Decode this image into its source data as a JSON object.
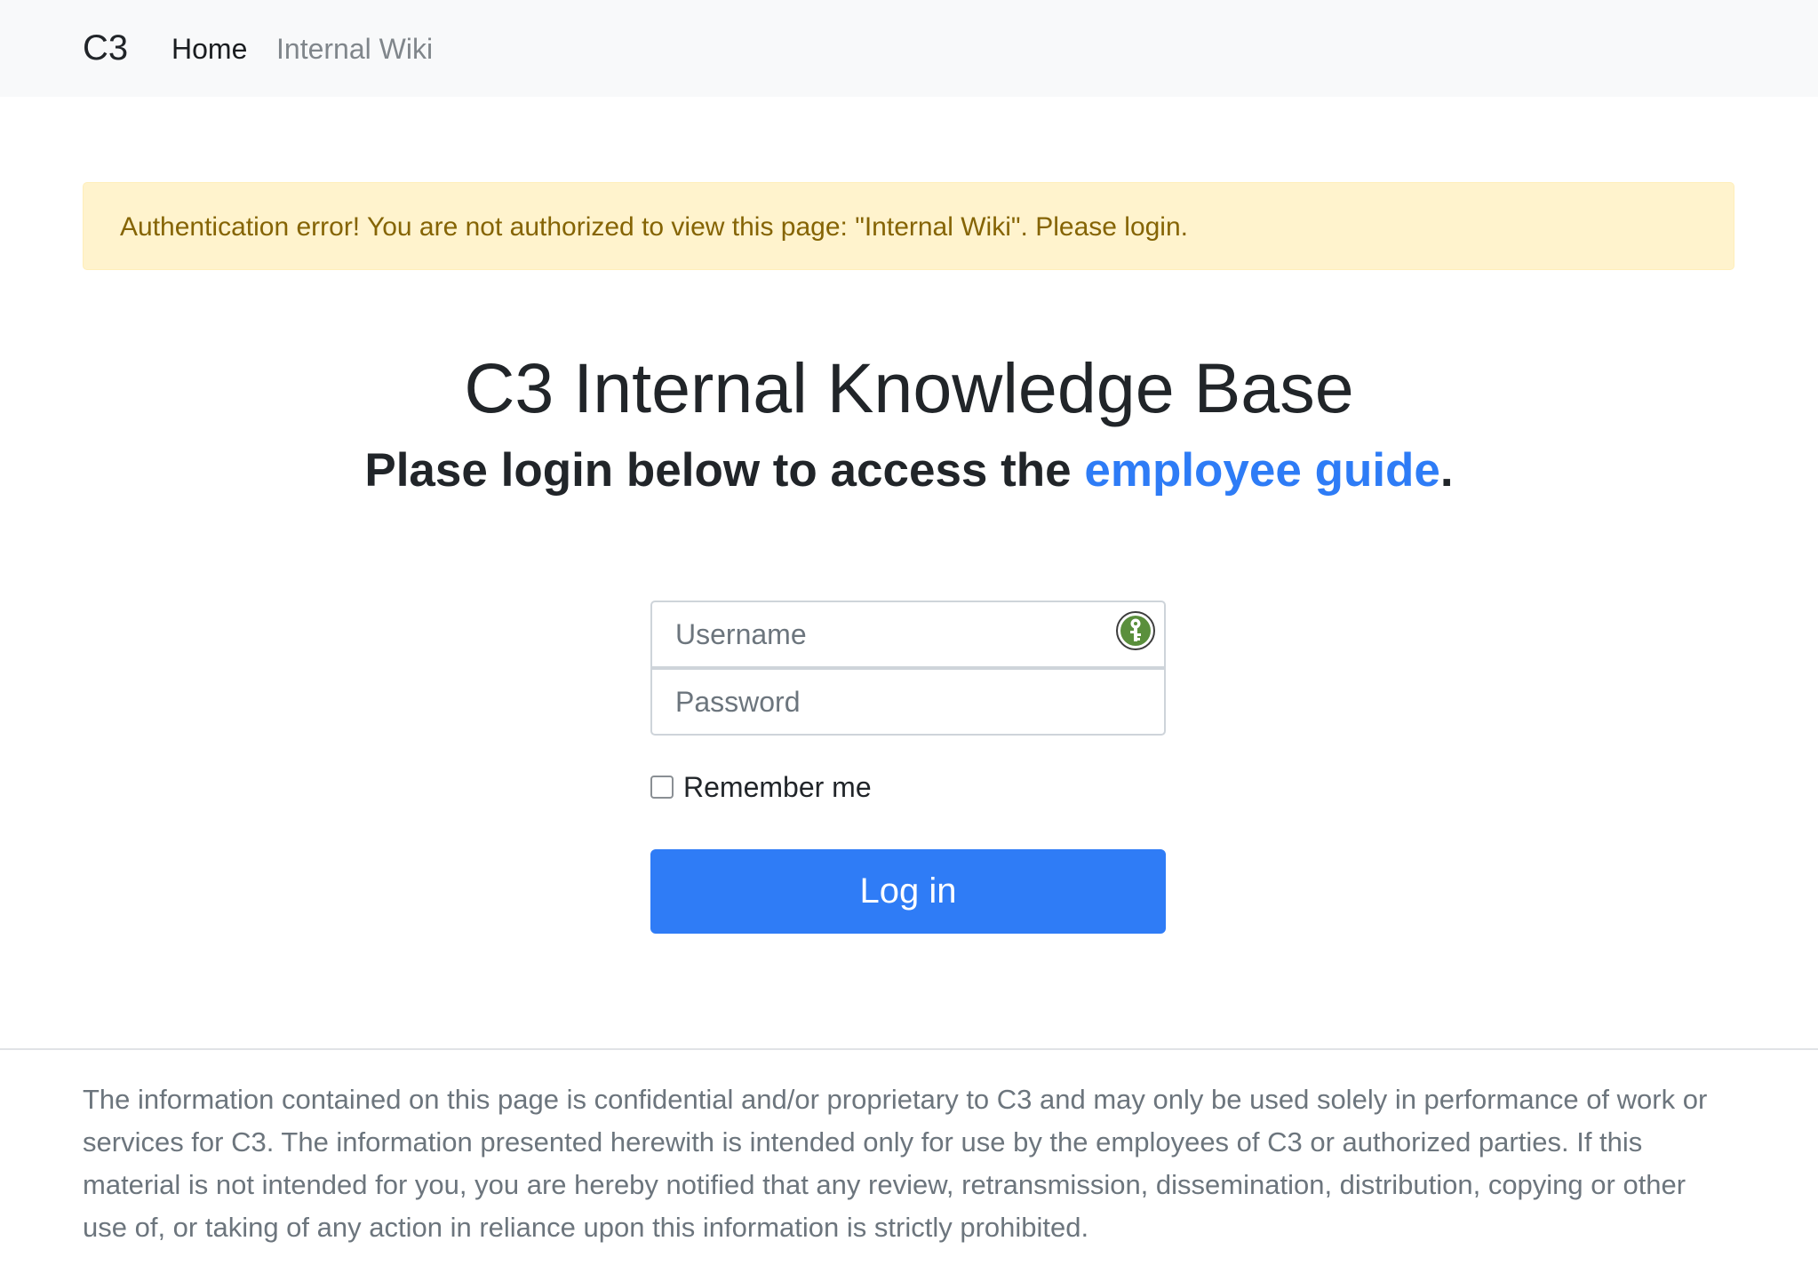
{
  "navbar": {
    "brand": "C3",
    "links": [
      {
        "label": "Home"
      },
      {
        "label": "Internal Wiki"
      }
    ]
  },
  "alert": {
    "message": "Authentication error! You are not authorized to view this page: \"Internal Wiki\". Please login."
  },
  "hero": {
    "title": "C3 Internal Knowledge Base",
    "subtitle_prefix": "Plase login below to access the ",
    "subtitle_link": "employee guide",
    "subtitle_suffix": "."
  },
  "login_form": {
    "username_placeholder": "Username",
    "username_value": "",
    "password_placeholder": "Password",
    "password_value": "",
    "remember_label": "Remember me",
    "remember_checked": false,
    "submit_label": "Log in",
    "password_manager_icon": "key-icon"
  },
  "footer": {
    "disclaimer": "The information contained on this page is confidential and/or proprietary to C3 and may only be used solely in performance of work or services for C3. The information presented herewith is intended only for use by the employees of C3 or authorized parties. If this material is not intended for you, you are hereby notified that any review, retransmission, dissemination, distribution, copying or other use of, or taking of any action in reliance upon this information is strictly prohibited."
  },
  "colors": {
    "navbar_bg": "#f8f9fa",
    "alert_bg": "#fff3cd",
    "alert_text": "#856404",
    "primary": "#2f7cf6",
    "link": "#2e7cf6",
    "muted_text": "#6c757d",
    "password_manager_green": "#5a8f3c"
  }
}
